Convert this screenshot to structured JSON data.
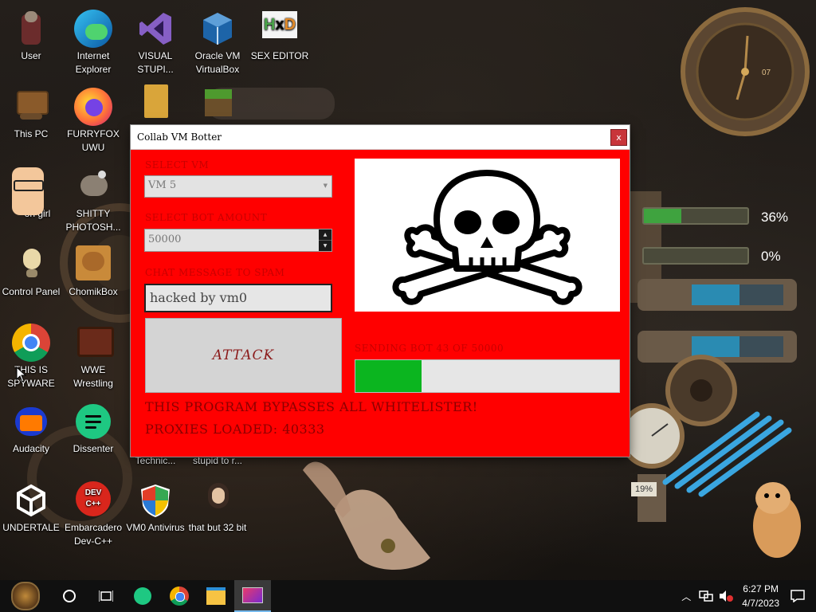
{
  "desktop": {
    "icons": [
      {
        "label": "User"
      },
      {
        "label": "Internet Explorer"
      },
      {
        "label": "VISUAL STUPI..."
      },
      {
        "label": "Oracle VM VirtualBox"
      },
      {
        "label": "SEX EDITOR"
      },
      {
        "label": "This PC"
      },
      {
        "label": "FURRYFOX UWU"
      },
      {
        "label": "on girl"
      },
      {
        "label": "SHITTY PHOTOSH..."
      },
      {
        "label": "Control Panel"
      },
      {
        "label": "ChomikBox"
      },
      {
        "label": "THIS IS SPYWARE"
      },
      {
        "label": "WWE Wrestling"
      },
      {
        "label": "Audacity"
      },
      {
        "label": "Dissenter"
      },
      {
        "label": "Technic..."
      },
      {
        "label": "stupid to r..."
      },
      {
        "label": "UNDERTALE"
      },
      {
        "label": "Embarcadero Dev-C++"
      },
      {
        "label": "VM0 Antivirus"
      },
      {
        "label": "that but 32 bit"
      }
    ],
    "gauges": [
      {
        "percent_text": "36%",
        "fill": 0.36
      },
      {
        "percent_text": "0%",
        "fill": 0.0
      }
    ],
    "clock_widget": {
      "day": "07"
    },
    "pressure_gauge_text": "19%"
  },
  "window": {
    "title": "Collab VM Botter",
    "close_label": "x",
    "select_vm_label": "SELECT VM",
    "select_vm_value": "VM 5",
    "bot_amount_label": "SELECT BOT AMOUNT",
    "bot_amount_value": "50000",
    "chat_label": "CHAT MESSAGE TO SPAM",
    "chat_value": "hacked by vm0",
    "attack_label": "ATTACK",
    "sending_text": "SENDING BOT 43 OF 50000",
    "progress_fraction": 0.25,
    "bypass_text": "THIS PROGRAM BYPASSES ALL WHITELISTER!",
    "proxies_text": "PROXIES LOADED: 40333"
  },
  "taskbar": {
    "time": "6:27 PM",
    "date": "4/7/2023"
  },
  "colors": {
    "window_bg": "#ff0000",
    "progress_fill": "#0bb51f",
    "label_red": "#c80000"
  }
}
